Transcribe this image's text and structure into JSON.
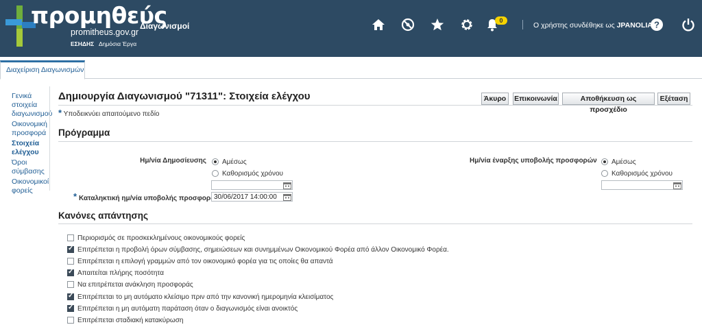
{
  "header": {
    "brand": "προμηθεύς",
    "url": "promitheus.gov.gr",
    "sub1": "ΕΣΗΔΗΣ",
    "sub2": "Δημόσια Έργα",
    "app_name": "Διαγωνισμοί",
    "notification_count": "0",
    "user_prefix": "Ο χρήστης συνδέθηκε ως",
    "username": "JPANOLIAS",
    "icons": [
      "home-icon",
      "navigator-icon",
      "favorites-icon",
      "settings-icon",
      "bell-icon",
      "help-icon",
      "power-icon"
    ]
  },
  "tabs": [
    {
      "label": "Διαχείριση Διαγωνισμών"
    }
  ],
  "leftnav": [
    {
      "label": "Γενικά στοιχεία διαγωνισμού"
    },
    {
      "label": "Οικονομική προσφορά"
    },
    {
      "label": "Στοιχεία ελέγχου"
    },
    {
      "label": "Όροι σύμβασης"
    },
    {
      "label": "Οικονομικοί φορείς"
    }
  ],
  "page": {
    "title": "Δημιουργία Διαγωνισμού \"71311\": Στοιχεία ελέγχου",
    "required_note": "Υποδεικνύει απαιτούμενο πεδίο",
    "buttons": {
      "cancel": "Άκυρο",
      "communication": "Επικοινωνία",
      "save_draft": "Αποθήκευση ως προσχέδιο",
      "review": "Εξέταση"
    }
  },
  "schedule": {
    "heading": "Πρόγραμμα",
    "publish_label": "Ημ/νία Δημοσίευσης",
    "publish_opt1": "Αμέσως",
    "publish_opt2": "Καθορισμός χρόνου",
    "publish_value": "",
    "deadline_label": "Καταληκτική ημ/νία υποβολής προσφορών",
    "deadline_value": "30/06/2017 14:00:00",
    "start_label": "Ημ/νία έναρξης υποβολής προσφορών",
    "start_opt1": "Αμέσως",
    "start_opt2": "Καθορισμός χρόνου",
    "start_value": ""
  },
  "rules": {
    "heading": "Κανόνες απάντησης",
    "items": [
      {
        "label": "Περιορισμός σε προσκεκλημένους οικονομικούς φορείς",
        "checked": false
      },
      {
        "label": "Επιτρέπεται η προβολή όρων σύμβασης, σημειώσεων και συνημμένων Οικονομικού Φορέα από άλλον Οικονομικό Φορέα.",
        "checked": true
      },
      {
        "label": "Επιτρέπεται η επιλογή γραμμών από τον οικονομικό φορέα για τις οποίες θα απαντά",
        "checked": false
      },
      {
        "label": "Απαιτείται πλήρης ποσότητα",
        "checked": true
      },
      {
        "label": "Να επιτρέπεται ανάκληση προσφοράς",
        "checked": false
      },
      {
        "label": "Επιτρέπεται το μη αυτόματο κλείσιμο πριν από την κανονική ημερομηνία κλεισίματος",
        "checked": true
      },
      {
        "label": "Επιτρέπεται η μη αυτόματη παράταση όταν ο διαγωνισμός είναι ανοικτός",
        "checked": true
      },
      {
        "label": "Επιτρέπεται σταδιακή κατακύρωση",
        "checked": false
      }
    ]
  }
}
